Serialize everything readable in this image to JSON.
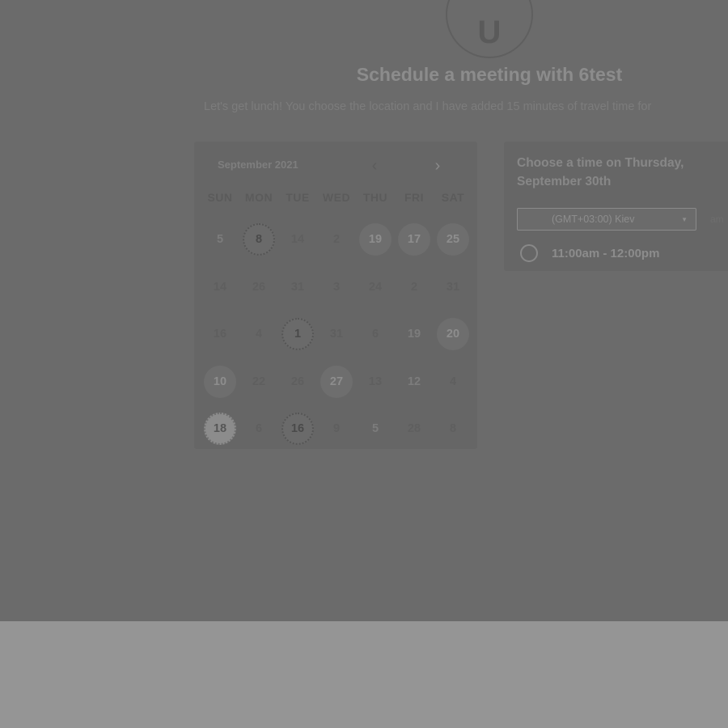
{
  "header": {
    "avatar_letter": "U",
    "title": "Schedule a meeting with 6test",
    "subtitle": "Let's get lunch! You choose the location and I have added 15 minutes of travel time for"
  },
  "calendar": {
    "month_label": "September 2021",
    "prev_icon": "chevron-left-icon",
    "next_icon": "chevron-right-icon",
    "weekdays": [
      "SUN",
      "MON",
      "TUE",
      "WED",
      "THU",
      "FRI",
      "SAT"
    ],
    "weeks": [
      [
        {
          "label": "5",
          "state": "muted-avail"
        },
        {
          "label": "8",
          "state": "dotted"
        },
        {
          "label": "14",
          "state": "disabled"
        },
        {
          "label": "2",
          "state": "disabled"
        },
        {
          "label": "19",
          "state": "avail"
        },
        {
          "label": "17",
          "state": "avail"
        },
        {
          "label": "25",
          "state": "avail"
        }
      ],
      [
        {
          "label": "14",
          "state": "disabled"
        },
        {
          "label": "26",
          "state": "disabled"
        },
        {
          "label": "31",
          "state": "disabled"
        },
        {
          "label": "3",
          "state": "disabled"
        },
        {
          "label": "24",
          "state": "disabled"
        },
        {
          "label": "2",
          "state": "disabled"
        },
        {
          "label": "31",
          "state": "disabled"
        }
      ],
      [
        {
          "label": "16",
          "state": "disabled"
        },
        {
          "label": "4",
          "state": "disabled"
        },
        {
          "label": "1",
          "state": "dotted"
        },
        {
          "label": "31",
          "state": "disabled"
        },
        {
          "label": "6",
          "state": "disabled"
        },
        {
          "label": "19",
          "state": "muted-avail"
        },
        {
          "label": "20",
          "state": "avail"
        }
      ],
      [
        {
          "label": "10",
          "state": "avail"
        },
        {
          "label": "22",
          "state": "disabled"
        },
        {
          "label": "26",
          "state": "disabled"
        },
        {
          "label": "27",
          "state": "avail"
        },
        {
          "label": "13",
          "state": "disabled"
        },
        {
          "label": "12",
          "state": "muted-avail"
        },
        {
          "label": "4",
          "state": "disabled"
        }
      ],
      [
        {
          "label": "18",
          "state": "selected"
        },
        {
          "label": "6",
          "state": "disabled"
        },
        {
          "label": "16",
          "state": "dotted"
        },
        {
          "label": "9",
          "state": "disabled"
        },
        {
          "label": "5",
          "state": "muted-avail"
        },
        {
          "label": "28",
          "state": "disabled"
        },
        {
          "label": "8",
          "state": "disabled"
        }
      ]
    ]
  },
  "times": {
    "heading": "Choose a time on Thursday, September 30th",
    "timezone": "(GMT+03:00) Kiev",
    "dropdown_icon": "caret-down-icon",
    "ampm_label": "am",
    "slots": [
      {
        "label": "11:00am - 12:00pm"
      }
    ]
  }
}
